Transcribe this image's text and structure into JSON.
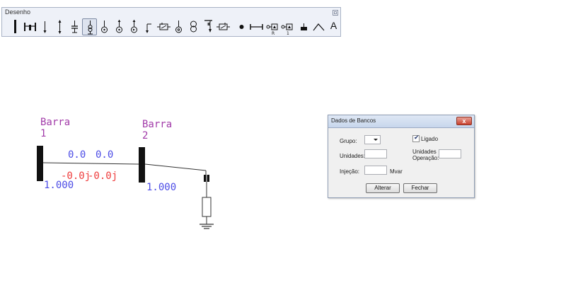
{
  "toolbar": {
    "title": "Desenho",
    "text_tool_label": "A",
    "tools": [
      "bus-bar-tool-icon",
      "transmission-line-tool-icon",
      "load-tool-icon",
      "line-connector-tool-icon",
      "capacitor-bank-tool-icon",
      "transformer-tool-icon",
      "generator-tool-icon",
      "synchronous-machine-tool-icon",
      "motor-tool-icon",
      "branch-tool-icon",
      "resistor-tool-icon",
      "source-tool-icon",
      "two-winding-transformer-tool-icon",
      "ground-tool-icon",
      "impedance-tool-icon",
      "node-point-tool-icon",
      "line-segment-tool-icon",
      "relay-r-tool-icon",
      "relay-1-tool-icon",
      "shunt-tool-icon",
      "angle-tool-icon",
      "text-tool-icon"
    ]
  },
  "diagram": {
    "bus1": {
      "label_line1": "Barra",
      "label_line2": "1",
      "voltage": "1.000"
    },
    "bus2": {
      "label_line1": "Barra",
      "label_line2": "2",
      "voltage": "1.000"
    },
    "line_flow": {
      "active": "0.0",
      "reactive": "0.0",
      "loss_active": "-0.0j",
      "loss_reactive": "-0.0j"
    },
    "colors": {
      "bus_label": "#a23ba9",
      "flow_blue": "#4c4ce6",
      "flow_red": "#ee3b3b"
    }
  },
  "dialog": {
    "title": "Dados de Bancos",
    "close_glyph": "x",
    "grupo_label": "Grupo:",
    "grupo_value": "",
    "ligado_label": "Ligado",
    "ligado_checked_glyph": "✔",
    "unidades_label": "Unidades:",
    "unidades_value": "",
    "unidades_operacao_line1": "Unidades",
    "unidades_operacao_line2": "Operação:",
    "unidades_operacao_value": "",
    "injecao_label": "Injeção:",
    "injecao_value": "",
    "injecao_unit": "Mvar",
    "alterar_label": "Alterar",
    "fechar_label": "Fechar"
  }
}
